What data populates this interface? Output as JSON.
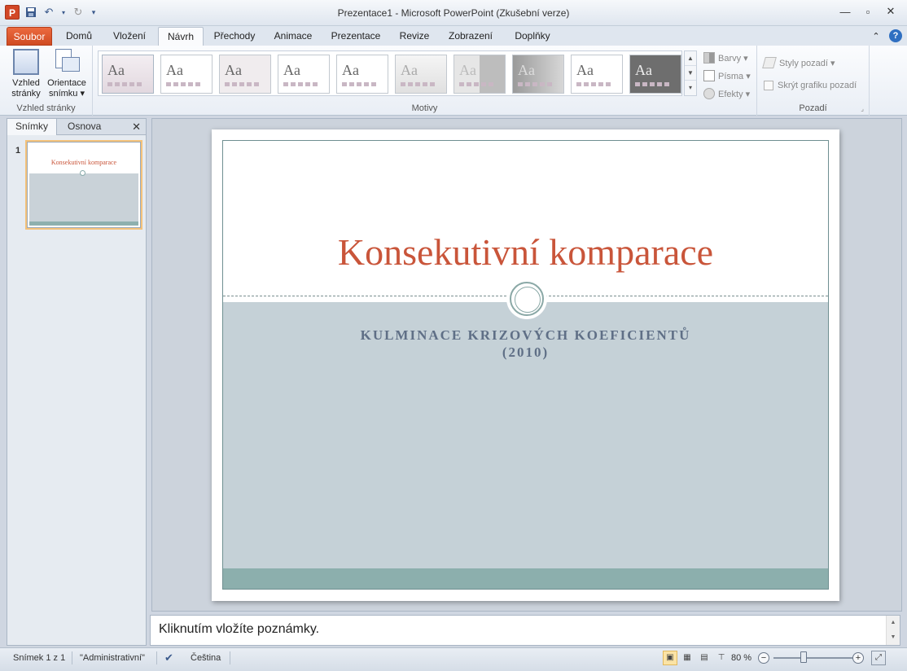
{
  "titlebar": {
    "title": "Prezentace1  -  Microsoft PowerPoint (Zkušební verze)",
    "logo": "P"
  },
  "tabs": {
    "file": "Soubor",
    "home": "Domů",
    "insert": "Vložení",
    "design": "Návrh",
    "transitions": "Přechody",
    "animations": "Animace",
    "slideshow": "Prezentace",
    "review": "Revize",
    "view": "Zobrazení",
    "addins": "Doplňky"
  },
  "ribbon": {
    "page_setup": {
      "setup_label": "Vzhled\nstránky",
      "orientation_label": "Orientace\nsnímku ▾",
      "group_label": "Vzhled stránky"
    },
    "themes": {
      "group_label": "Motivy",
      "aa": "Aa"
    },
    "theme_options": {
      "colors": "Barvy ▾",
      "fonts": "Písma ▾",
      "effects": "Efekty ▾"
    },
    "background": {
      "styles": "Styly pozadí ▾",
      "hide_graphics": "Skrýt grafiku pozadí",
      "group_label": "Pozadí"
    }
  },
  "left_pane": {
    "tab_slides": "Snímky",
    "tab_outline": "Osnova",
    "slide_number": "1",
    "thumb_title": "Konsekutivní komparace"
  },
  "slide": {
    "title": "Konsekutivní komparace",
    "subtitle_line1": "KULMINACE KRIZOVÝCH KOEFICIENTŮ",
    "subtitle_line2": "(2010)"
  },
  "notes": {
    "placeholder": "Kliknutím vložíte poznámky."
  },
  "status": {
    "slide_info": "Snímek 1 z 1",
    "theme_name": "\"Administrativní\"",
    "language": "Čeština",
    "zoom": "80 %"
  },
  "colors": {
    "accent_file": "#d04b22",
    "title_color": "#c9553a",
    "subtitle_color": "#5f6f86",
    "slide_lower_bg": "#c5d1d7",
    "slide_footer": "#8cafad"
  }
}
